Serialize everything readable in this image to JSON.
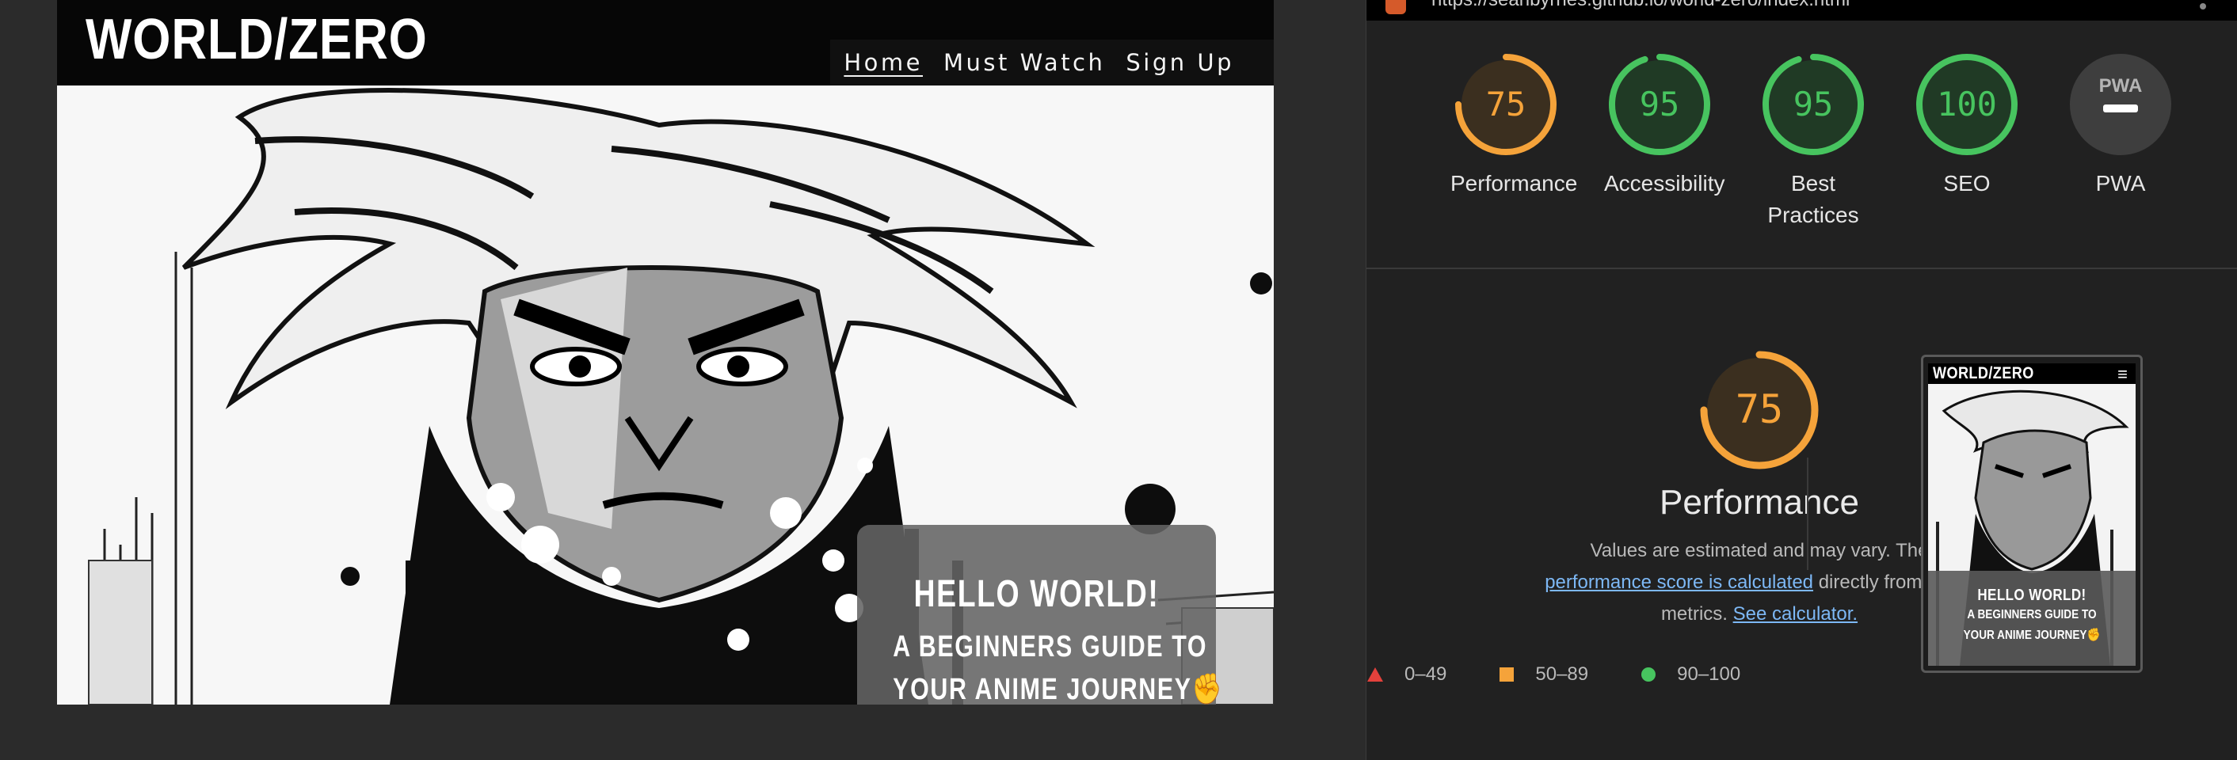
{
  "site": {
    "logo": "WORLD/ZERO",
    "nav": [
      "Home",
      "Must Watch",
      "Sign Up"
    ],
    "hero": {
      "title": "HELLO WORLD!",
      "subtitle_line1": "A BEGINNERS GUIDE TO",
      "subtitle_line2": "YOUR ANIME JOURNEY✊"
    }
  },
  "lighthouse": {
    "url": "https://seanbyrnes.github.io/world-zero/index.html",
    "scores": [
      {
        "label": "Performance",
        "value": 75,
        "color": "#f5a33a"
      },
      {
        "label": "Accessibility",
        "value": 95,
        "color": "#47c45f"
      },
      {
        "label": "Best Practices",
        "value": 95,
        "color": "#47c45f"
      },
      {
        "label": "SEO",
        "value": 100,
        "color": "#47c45f"
      },
      {
        "label": "PWA",
        "value": null,
        "color": "#9a9a9a"
      }
    ],
    "pwa_badge": "PWA",
    "detail": {
      "score": 75,
      "title": "Performance",
      "desc_prefix": "Values are estimated and may vary. The",
      "desc_link1": "performance score is calculated",
      "desc_mid": "directly from these metrics.",
      "desc_link2": "See calculator."
    },
    "legend": [
      {
        "range": "0–49",
        "color": "#e3413c",
        "shape": "triangle"
      },
      {
        "range": "50–89",
        "color": "#f5a33a",
        "shape": "square"
      },
      {
        "range": "90–100",
        "color": "#47c45f",
        "shape": "circle"
      }
    ],
    "thumbnail": {
      "logo": "WORLD/ZERO",
      "menu_icon": "hamburger-icon",
      "line1": "HELLO WORLD!",
      "line2": "A BEGINNERS GUIDE TO",
      "line3": "YOUR ANIME JOURNEY✊"
    }
  }
}
